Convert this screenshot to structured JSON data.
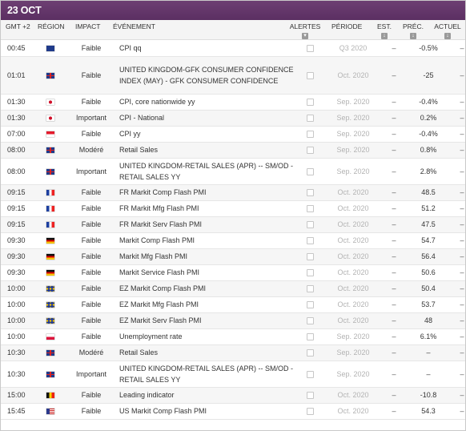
{
  "date_label": "23 OCT",
  "headers": {
    "time": "GMT +2",
    "region": "RÉGION",
    "impact": "IMPACT",
    "event": "ÉVÉNEMENT",
    "alerts": "ALERTES",
    "period": "PÉRIODE",
    "est": "EST.",
    "prev": "PRÉC.",
    "actual": "ACTUEL"
  },
  "icons": {
    "alerts": "bell-icon",
    "est": "sort-arrow-icon",
    "prev": "sort-arrow-icon",
    "actual": "sort-arrow-icon"
  },
  "rows": [
    {
      "time": "00:45",
      "flag": "new-zealand",
      "impact": "Faible",
      "event": "CPI qq",
      "period": "Q3 2020",
      "est": "–",
      "prev": "-0.5%",
      "actual": "–",
      "h": "std"
    },
    {
      "time": "01:01",
      "flag": "united-kingdom",
      "impact": "Faible",
      "event": "UNITED KINGDOM-GFK CONSUMER CONFIDENCE INDEX (MAY) - GFK CONSUMER CONFIDENCE",
      "period": "Oct. 2020",
      "est": "–",
      "prev": "-25",
      "actual": "–",
      "h": "tall"
    },
    {
      "time": "01:30",
      "flag": "japan",
      "impact": "Faible",
      "event": "CPI, core nationwide yy",
      "period": "Sep. 2020",
      "est": "–",
      "prev": "-0.4%",
      "actual": "–",
      "h": "std"
    },
    {
      "time": "01:30",
      "flag": "japan",
      "impact": "Important",
      "event": "CPI - National",
      "period": "Sep. 2020",
      "est": "–",
      "prev": "0.2%",
      "actual": "–",
      "h": "std"
    },
    {
      "time": "07:00",
      "flag": "singapore",
      "impact": "Faible",
      "event": "CPI yy",
      "period": "Sep. 2020",
      "est": "–",
      "prev": "-0.4%",
      "actual": "–",
      "h": "std"
    },
    {
      "time": "08:00",
      "flag": "united-kingdom",
      "impact": "Modéré",
      "event": "Retail Sales",
      "period": "Sep. 2020",
      "est": "–",
      "prev": "0.8%",
      "actual": "–",
      "h": "std"
    },
    {
      "time": "08:00",
      "flag": "united-kingdom",
      "impact": "Important",
      "event": "UNITED KINGDOM-RETAIL SALES (APR) -- SM/OD - RETAIL SALES YY",
      "period": "Sep. 2020",
      "est": "–",
      "prev": "2.8%",
      "actual": "–",
      "h": "med"
    },
    {
      "time": "09:15",
      "flag": "france",
      "impact": "Faible",
      "event": "FR Markit Comp Flash PMI",
      "period": "Oct. 2020",
      "est": "–",
      "prev": "48.5",
      "actual": "–",
      "h": "std"
    },
    {
      "time": "09:15",
      "flag": "france",
      "impact": "Faible",
      "event": "FR Markit Mfg Flash PMI",
      "period": "Oct. 2020",
      "est": "–",
      "prev": "51.2",
      "actual": "–",
      "h": "std"
    },
    {
      "time": "09:15",
      "flag": "france",
      "impact": "Faible",
      "event": "FR Markit Serv Flash PMI",
      "period": "Oct. 2020",
      "est": "–",
      "prev": "47.5",
      "actual": "–",
      "h": "std"
    },
    {
      "time": "09:30",
      "flag": "germany",
      "impact": "Faible",
      "event": "Markit Comp Flash PMI",
      "period": "Oct. 2020",
      "est": "–",
      "prev": "54.7",
      "actual": "–",
      "h": "std"
    },
    {
      "time": "09:30",
      "flag": "germany",
      "impact": "Faible",
      "event": "Markit Mfg Flash PMI",
      "period": "Oct. 2020",
      "est": "–",
      "prev": "56.4",
      "actual": "–",
      "h": "std"
    },
    {
      "time": "09:30",
      "flag": "germany",
      "impact": "Faible",
      "event": "Markit Service Flash PMI",
      "period": "Oct. 2020",
      "est": "–",
      "prev": "50.6",
      "actual": "–",
      "h": "std"
    },
    {
      "time": "10:00",
      "flag": "european-union",
      "impact": "Faible",
      "event": "EZ Markit Comp Flash PMI",
      "period": "Oct. 2020",
      "est": "–",
      "prev": "50.4",
      "actual": "–",
      "h": "std"
    },
    {
      "time": "10:00",
      "flag": "european-union",
      "impact": "Faible",
      "event": "EZ Markit Mfg Flash PMI",
      "period": "Oct. 2020",
      "est": "–",
      "prev": "53.7",
      "actual": "–",
      "h": "std"
    },
    {
      "time": "10:00",
      "flag": "european-union",
      "impact": "Faible",
      "event": "EZ Markit Serv Flash PMI",
      "period": "Oct. 2020",
      "est": "–",
      "prev": "48",
      "actual": "–",
      "h": "std"
    },
    {
      "time": "10:00",
      "flag": "poland",
      "impact": "Faible",
      "event": "Unemployment rate",
      "period": "Sep. 2020",
      "est": "–",
      "prev": "6.1%",
      "actual": "–",
      "h": "std"
    },
    {
      "time": "10:30",
      "flag": "united-kingdom",
      "impact": "Modéré",
      "event": "Retail Sales",
      "period": "Sep. 2020",
      "est": "–",
      "prev": "–",
      "actual": "–",
      "h": "std"
    },
    {
      "time": "10:30",
      "flag": "united-kingdom",
      "impact": "Important",
      "event": "UNITED KINGDOM-RETAIL SALES (APR) -- SM/OD - RETAIL SALES YY",
      "period": "Sep. 2020",
      "est": "–",
      "prev": "–",
      "actual": "–",
      "h": "med"
    },
    {
      "time": "15:00",
      "flag": "belgium",
      "impact": "Faible",
      "event": "Leading indicator",
      "period": "Oct. 2020",
      "est": "–",
      "prev": "-10.8",
      "actual": "–",
      "h": "std"
    },
    {
      "time": "15:45",
      "flag": "united-states",
      "impact": "Faible",
      "event": "US Markit Comp Flash PMI",
      "period": "Oct. 2020",
      "est": "–",
      "prev": "54.3",
      "actual": "–",
      "h": "std"
    }
  ],
  "colors": {
    "date_bar": "#5b2f62",
    "period_text": "#b3b3b3"
  }
}
